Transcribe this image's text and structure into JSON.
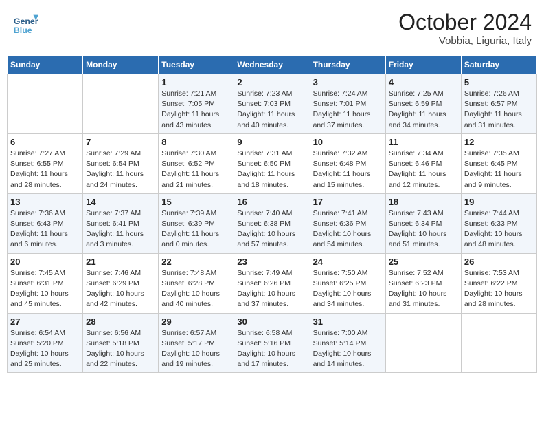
{
  "header": {
    "logo_general": "General",
    "logo_blue": "Blue",
    "month": "October 2024",
    "location": "Vobbia, Liguria, Italy"
  },
  "days_of_week": [
    "Sunday",
    "Monday",
    "Tuesday",
    "Wednesday",
    "Thursday",
    "Friday",
    "Saturday"
  ],
  "weeks": [
    [
      {
        "day": "",
        "info": ""
      },
      {
        "day": "",
        "info": ""
      },
      {
        "day": "1",
        "info": "Sunrise: 7:21 AM\nSunset: 7:05 PM\nDaylight: 11 hours and 43 minutes."
      },
      {
        "day": "2",
        "info": "Sunrise: 7:23 AM\nSunset: 7:03 PM\nDaylight: 11 hours and 40 minutes."
      },
      {
        "day": "3",
        "info": "Sunrise: 7:24 AM\nSunset: 7:01 PM\nDaylight: 11 hours and 37 minutes."
      },
      {
        "day": "4",
        "info": "Sunrise: 7:25 AM\nSunset: 6:59 PM\nDaylight: 11 hours and 34 minutes."
      },
      {
        "day": "5",
        "info": "Sunrise: 7:26 AM\nSunset: 6:57 PM\nDaylight: 11 hours and 31 minutes."
      }
    ],
    [
      {
        "day": "6",
        "info": "Sunrise: 7:27 AM\nSunset: 6:55 PM\nDaylight: 11 hours and 28 minutes."
      },
      {
        "day": "7",
        "info": "Sunrise: 7:29 AM\nSunset: 6:54 PM\nDaylight: 11 hours and 24 minutes."
      },
      {
        "day": "8",
        "info": "Sunrise: 7:30 AM\nSunset: 6:52 PM\nDaylight: 11 hours and 21 minutes."
      },
      {
        "day": "9",
        "info": "Sunrise: 7:31 AM\nSunset: 6:50 PM\nDaylight: 11 hours and 18 minutes."
      },
      {
        "day": "10",
        "info": "Sunrise: 7:32 AM\nSunset: 6:48 PM\nDaylight: 11 hours and 15 minutes."
      },
      {
        "day": "11",
        "info": "Sunrise: 7:34 AM\nSunset: 6:46 PM\nDaylight: 11 hours and 12 minutes."
      },
      {
        "day": "12",
        "info": "Sunrise: 7:35 AM\nSunset: 6:45 PM\nDaylight: 11 hours and 9 minutes."
      }
    ],
    [
      {
        "day": "13",
        "info": "Sunrise: 7:36 AM\nSunset: 6:43 PM\nDaylight: 11 hours and 6 minutes."
      },
      {
        "day": "14",
        "info": "Sunrise: 7:37 AM\nSunset: 6:41 PM\nDaylight: 11 hours and 3 minutes."
      },
      {
        "day": "15",
        "info": "Sunrise: 7:39 AM\nSunset: 6:39 PM\nDaylight: 11 hours and 0 minutes."
      },
      {
        "day": "16",
        "info": "Sunrise: 7:40 AM\nSunset: 6:38 PM\nDaylight: 10 hours and 57 minutes."
      },
      {
        "day": "17",
        "info": "Sunrise: 7:41 AM\nSunset: 6:36 PM\nDaylight: 10 hours and 54 minutes."
      },
      {
        "day": "18",
        "info": "Sunrise: 7:43 AM\nSunset: 6:34 PM\nDaylight: 10 hours and 51 minutes."
      },
      {
        "day": "19",
        "info": "Sunrise: 7:44 AM\nSunset: 6:33 PM\nDaylight: 10 hours and 48 minutes."
      }
    ],
    [
      {
        "day": "20",
        "info": "Sunrise: 7:45 AM\nSunset: 6:31 PM\nDaylight: 10 hours and 45 minutes."
      },
      {
        "day": "21",
        "info": "Sunrise: 7:46 AM\nSunset: 6:29 PM\nDaylight: 10 hours and 42 minutes."
      },
      {
        "day": "22",
        "info": "Sunrise: 7:48 AM\nSunset: 6:28 PM\nDaylight: 10 hours and 40 minutes."
      },
      {
        "day": "23",
        "info": "Sunrise: 7:49 AM\nSunset: 6:26 PM\nDaylight: 10 hours and 37 minutes."
      },
      {
        "day": "24",
        "info": "Sunrise: 7:50 AM\nSunset: 6:25 PM\nDaylight: 10 hours and 34 minutes."
      },
      {
        "day": "25",
        "info": "Sunrise: 7:52 AM\nSunset: 6:23 PM\nDaylight: 10 hours and 31 minutes."
      },
      {
        "day": "26",
        "info": "Sunrise: 7:53 AM\nSunset: 6:22 PM\nDaylight: 10 hours and 28 minutes."
      }
    ],
    [
      {
        "day": "27",
        "info": "Sunrise: 6:54 AM\nSunset: 5:20 PM\nDaylight: 10 hours and 25 minutes."
      },
      {
        "day": "28",
        "info": "Sunrise: 6:56 AM\nSunset: 5:18 PM\nDaylight: 10 hours and 22 minutes."
      },
      {
        "day": "29",
        "info": "Sunrise: 6:57 AM\nSunset: 5:17 PM\nDaylight: 10 hours and 19 minutes."
      },
      {
        "day": "30",
        "info": "Sunrise: 6:58 AM\nSunset: 5:16 PM\nDaylight: 10 hours and 17 minutes."
      },
      {
        "day": "31",
        "info": "Sunrise: 7:00 AM\nSunset: 5:14 PM\nDaylight: 10 hours and 14 minutes."
      },
      {
        "day": "",
        "info": ""
      },
      {
        "day": "",
        "info": ""
      }
    ]
  ]
}
